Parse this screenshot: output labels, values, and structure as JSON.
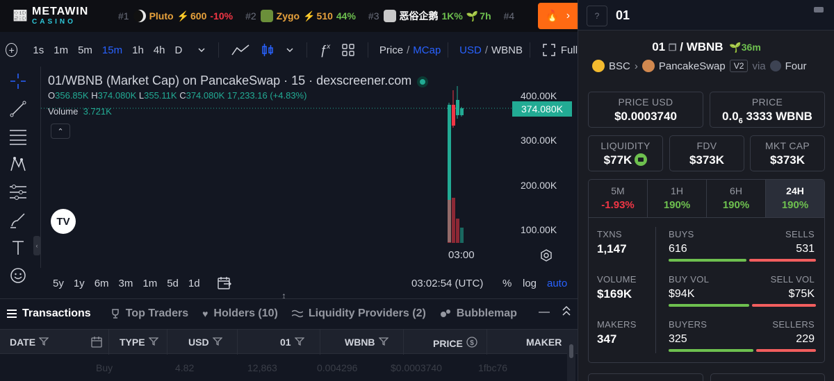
{
  "adbar": {
    "logo_top": "METAWIN",
    "logo_bottom": "CASINO",
    "trending": [
      {
        "rank": "#1",
        "name": "Pluto",
        "value": "600",
        "change": "-10%",
        "dir": "neg",
        "icon_color": "#111111"
      },
      {
        "rank": "#2",
        "name": "Zygo",
        "value": "510",
        "change": "44%",
        "dir": "pos",
        "icon_color": "#6b8f3a"
      },
      {
        "rank": "#3",
        "name": "恶俗企鹅",
        "value": "1K%",
        "change": "7h",
        "dir": "pos",
        "icon_color": "#c9c9c9"
      },
      {
        "rank": "#4",
        "name": "",
        "value": "",
        "change": "",
        "dir": "pos",
        "icon_color": "#333333"
      }
    ]
  },
  "toolbar": {
    "timeframes": [
      "1s",
      "1m",
      "5m",
      "15m",
      "1h",
      "4h",
      "D"
    ],
    "active_timeframe": "15m",
    "price_label": "Price",
    "mcap_label": "MCap",
    "usd_label": "USD",
    "wbnb_label": "WBNB",
    "full_label": "Full"
  },
  "chart": {
    "title": "01/WBNB (Market Cap) on PancakeSwap · 15 · dexscreener.com",
    "o_label": "O",
    "o": "356.85K",
    "h_label": "H",
    "h": "374.080K",
    "l_label": "L",
    "l": "355.11K",
    "c_label": "C",
    "c": "374.080K",
    "change": "17,233.16 (+4.83%)",
    "volume_label": "Volume",
    "volume": "3.721K",
    "y_ticks": [
      "400.00K",
      "300.00K",
      "200.00K",
      "100.00K"
    ],
    "last_price_tag": "374.080K",
    "x_tick": "03:00",
    "ranges": [
      "5y",
      "1y",
      "6m",
      "3m",
      "1m",
      "5d",
      "1d"
    ],
    "time": "03:02:54 (UTC)",
    "pct_label": "%",
    "log_label": "log",
    "auto_label": "auto",
    "logo_text": "TV"
  },
  "tabs": {
    "items": [
      "Transactions",
      "Top Traders",
      "Holders (10)",
      "Liquidity Providers (2)",
      "Bubblemap"
    ],
    "active": "Transactions"
  },
  "table": {
    "columns": [
      "DATE",
      "TYPE",
      "USD",
      "01",
      "WBNB",
      "PRICE",
      "MAKER"
    ],
    "row": [
      "",
      "Buy",
      "4.82",
      "12,863",
      "0.004296",
      "$0.0003740",
      "1fbc76"
    ]
  },
  "panel": {
    "token": "01",
    "pair_base": "01",
    "pair_quote": "WBNB",
    "age": "36m",
    "chain": "BSC",
    "dex": "PancakeSwap",
    "version": "V2",
    "via": "via",
    "via_name": "Four",
    "price_usd_label": "PRICE USD",
    "price_usd": "$0.0003740",
    "price_label": "PRICE",
    "price_native_prefix": "0.0",
    "price_native_sub": "6",
    "price_native_rest": "3333 WBNB",
    "liquidity_label": "LIQUIDITY",
    "liquidity": "$77K",
    "fdv_label": "FDV",
    "fdv": "$373K",
    "mktcap_label": "MKT CAP",
    "mktcap": "$373K",
    "timeframes": [
      {
        "label": "5M",
        "value": "-1.93%",
        "dir": "neg"
      },
      {
        "label": "1H",
        "value": "190%",
        "dir": "pos"
      },
      {
        "label": "6H",
        "value": "190%",
        "dir": "pos"
      },
      {
        "label": "24H",
        "value": "190%",
        "dir": "pos"
      }
    ],
    "txns_label": "TXNS",
    "txns": "1,147",
    "buys_label": "BUYS",
    "buys": "616",
    "sells_label": "SELLS",
    "sells": "531",
    "volume_label": "VOLUME",
    "volume": "$169K",
    "buyvol_label": "BUY VOL",
    "buyvol": "$94K",
    "sellvol_label": "SELL VOL",
    "sellvol": "$75K",
    "makers_label": "MAKERS",
    "makers": "347",
    "buyers_label": "BUYERS",
    "buyers": "325",
    "sellers_label": "SELLERS",
    "sellers": "229"
  },
  "colors": {
    "up": "#22ab94",
    "down": "#f23645",
    "accent": "#2962ff",
    "positive": "#6ec04f",
    "ad_button": "#ff6a13"
  }
}
